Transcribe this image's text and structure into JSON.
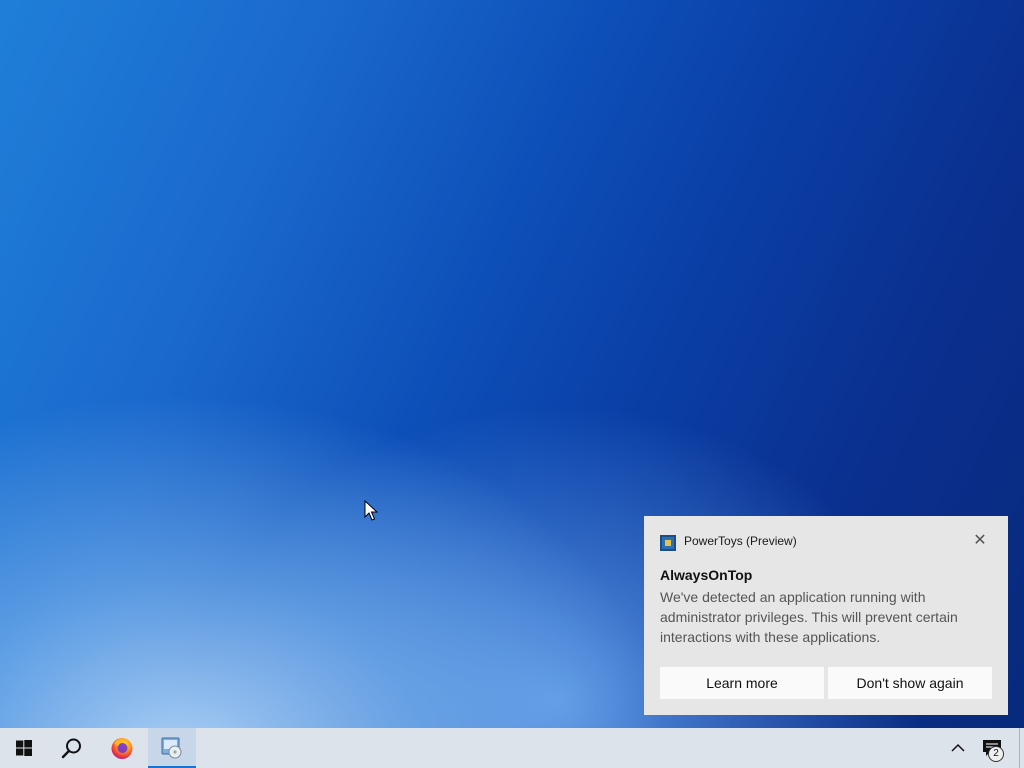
{
  "toast": {
    "app_name": "PowerToys (Preview)",
    "close_glyph": "✕",
    "title": "AlwaysOnTop",
    "body": "We've detected an application running with administrator privileges. This will prevent certain interactions with these applications.",
    "buttons": {
      "learn_more": "Learn more",
      "dont_show_again": "Don't show again"
    },
    "app_icon": "powertoys-icon"
  },
  "taskbar": {
    "items": [
      {
        "icon": "windows-start-icon"
      },
      {
        "icon": "search-icon"
      },
      {
        "icon": "firefox-icon"
      },
      {
        "icon": "app-cd-icon",
        "active": true
      }
    ],
    "tray": {
      "chevron_icon": "chevron-up-icon",
      "notifications_icon": "action-center-icon",
      "notification_count": "2"
    }
  },
  "colors": {
    "accent": "#1a73d0",
    "toast_bg": "#e6e6e6",
    "taskbar_bg": "#dde3ea"
  }
}
